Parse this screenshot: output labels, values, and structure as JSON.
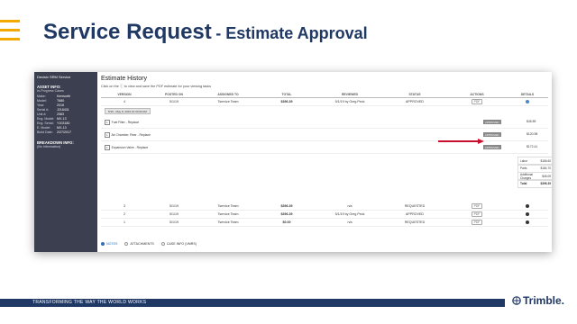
{
  "slide": {
    "title_main": "Service Request",
    "title_sub": "- Estimate Approval",
    "footer": "TRANSFORMING THE WAY THE WORLD WORKS",
    "logo": "Trimble."
  },
  "sidebar": {
    "dealer": "Decisiv SRM Service",
    "asset_header": "ASSET INFO:",
    "asset_sub": "In-Progress Cases",
    "fields": [
      {
        "k": "Make:",
        "v": "Kenworth"
      },
      {
        "k": "Model:",
        "v": "T680"
      },
      {
        "k": "Year:",
        "v": "2018"
      },
      {
        "k": "Serial #:",
        "v": "J218431"
      },
      {
        "k": "Unit #:",
        "v": "2583"
      },
      {
        "k": "Eng. Model:",
        "v": "MX-13"
      },
      {
        "k": "Eng. Serial:",
        "v": "Y103180"
      },
      {
        "k": "E. Model:",
        "v": "MX-13"
      },
      {
        "k": "Build Date:",
        "v": "2/27/2017"
      }
    ],
    "breakdown_header": "BREAKDOWN INFO:",
    "breakdown_value": "(No Information)"
  },
  "estimate": {
    "title": "Estimate History",
    "instructions": "Click on the ⓘ to view and save the PDF estimate for your viewing tasks",
    "columns": [
      "VERSION",
      "POSTED ON",
      "ASSIGNED TO",
      "TOTAL",
      "REVIEWED",
      "STATUS",
      "ACTIONS",
      "DETAILS"
    ],
    "top_row": {
      "version": "4",
      "posted": "5/1/19",
      "assigned": "Tservice Team",
      "total": "$396.39",
      "reviewed": "5/1/19 by Greg Peck",
      "status": "APPROVED",
      "action": "PDF"
    },
    "date_tag": "5/16 - May 8, 2019 10:30:00 AM",
    "repairs": [
      {
        "label": "Fuel Filter - Replace",
        "badge": "APPROVED",
        "amount": "$45.89"
      },
      {
        "label": "Air Chamber, Rear - Replace",
        "badge": "APPROVED",
        "amount": "$120.98"
      },
      {
        "label": "Expansion Valve - Replace",
        "badge": "APPROVED",
        "amount": "$172.41"
      }
    ],
    "totals": [
      {
        "k": "Labor",
        "v": "$166.60"
      },
      {
        "k": "Parts",
        "v": "$184.70"
      },
      {
        "k": "Additional Charges",
        "v": "$45.09"
      },
      {
        "k": "Total",
        "v": "$396.39"
      }
    ],
    "rows": [
      {
        "version": "3",
        "posted": "5/1/19",
        "assigned": "Tservice Team",
        "total": "$396.39",
        "reviewed": "n/a",
        "status": "REQUESTED",
        "action": "PDF"
      },
      {
        "version": "2",
        "posted": "5/1/19",
        "assigned": "Tservice Team",
        "total": "$396.39",
        "reviewed": "5/1/19 by Greg Peck",
        "status": "APPROVED",
        "action": "PDF"
      },
      {
        "version": "1",
        "posted": "5/1/19",
        "assigned": "Tservice Team",
        "total": "$0.00",
        "reviewed": "n/a",
        "status": "REQUESTED",
        "action": "PDF"
      }
    ],
    "tabs": [
      "NOTES",
      "ATTACHMENTS",
      "CASE INFO (VMRS)"
    ]
  },
  "colors": {
    "title": "#1f3864",
    "accent": "#f2a900",
    "arrow": "#c8102e"
  }
}
